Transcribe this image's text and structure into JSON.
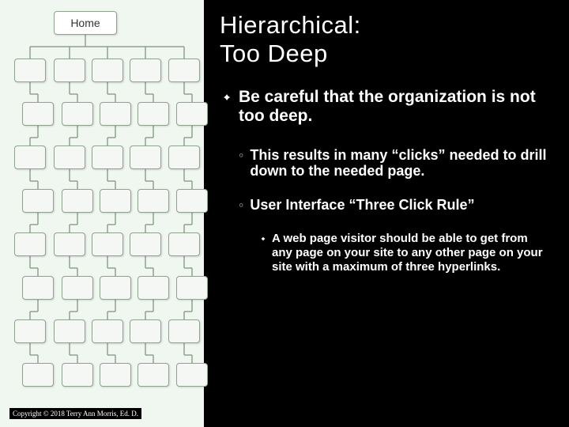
{
  "diagram": {
    "root_label": "Home"
  },
  "title": "Hierarchical:\nToo Deep",
  "bullets": {
    "main": "Be careful that the organization is not too deep.",
    "sub1": "This results in many “clicks” needed to drill down to the needed page.",
    "sub2": "User Interface “Three Click Rule”",
    "tertiary": "A web page visitor should be able to get from any page on your site to any other page on your site with a maximum of three hyperlinks."
  },
  "footer": {
    "copyright": "Copyright © 2018 Terry Ann Morris, Ed. D."
  }
}
